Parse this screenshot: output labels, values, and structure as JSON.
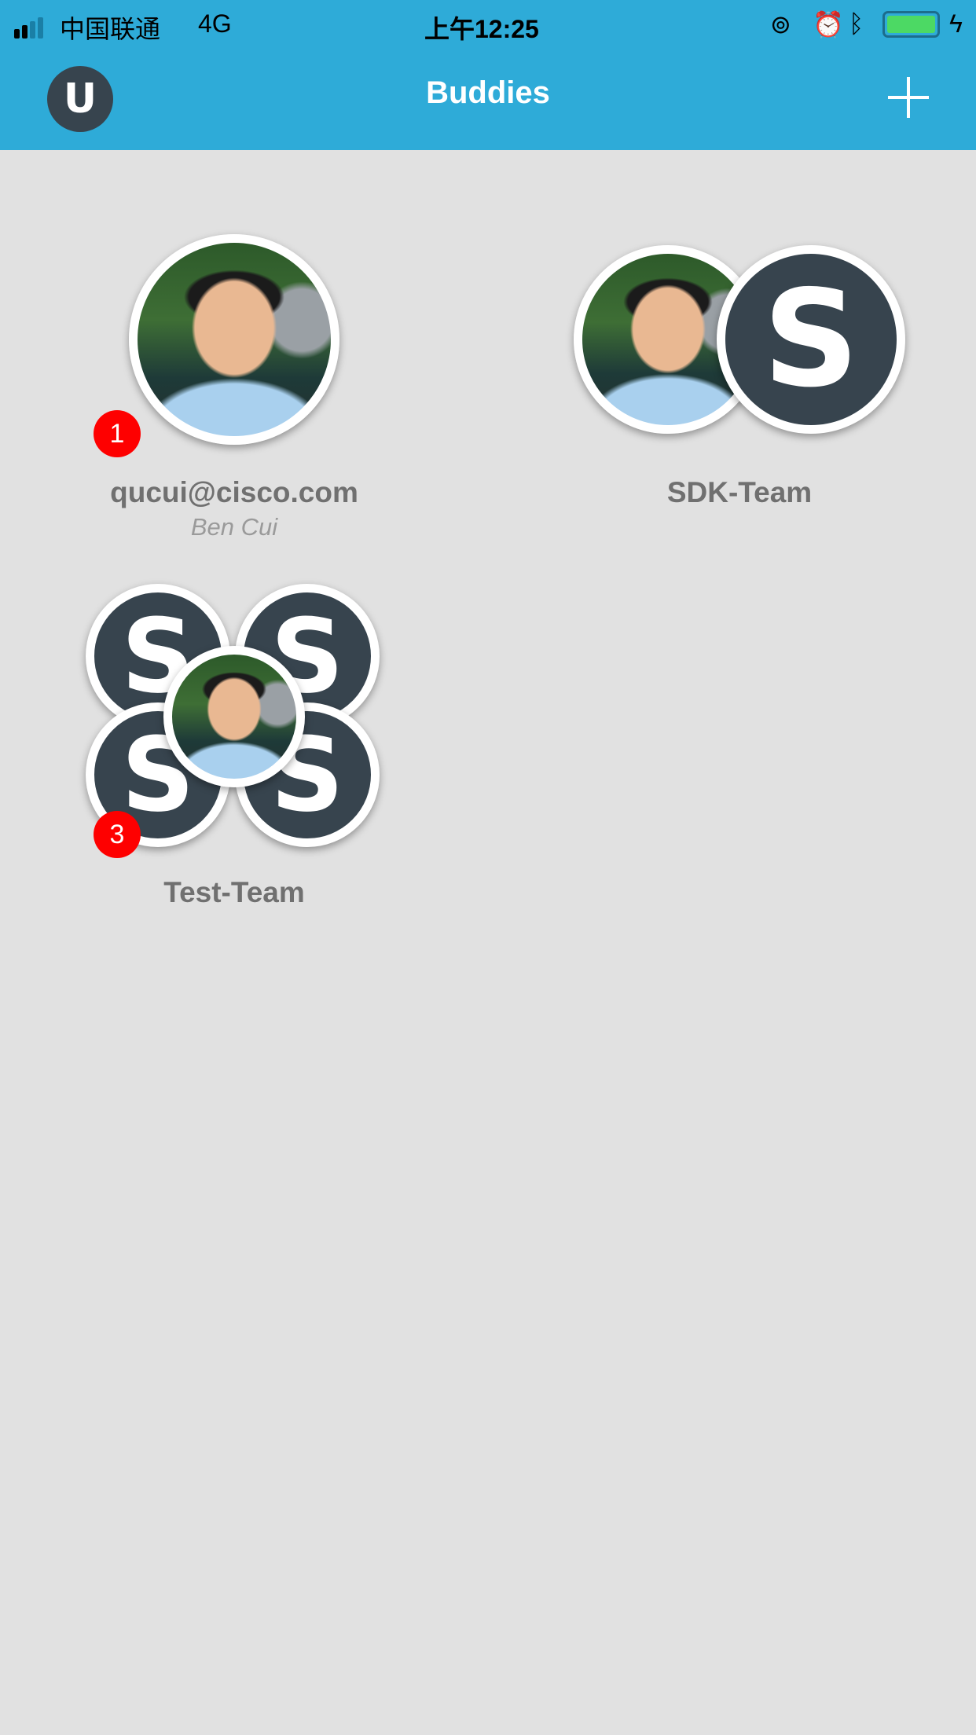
{
  "status_bar": {
    "carrier": "中国联通",
    "network": "4G",
    "time": "上午12:25"
  },
  "header": {
    "title": "Buddies",
    "user_initial": "U"
  },
  "buddies": [
    {
      "name": "qucui@cisco.com",
      "subtitle": "Ben Cui",
      "badge": "1"
    },
    {
      "name": "SDK-Team",
      "initial": "S"
    },
    {
      "name": "Test-Team",
      "initial": "S",
      "badge": "3"
    }
  ],
  "colors": {
    "header": "#2eabd8",
    "background": "#e1e1e1",
    "avatar_dark": "#37444e",
    "badge": "#fe0000"
  }
}
